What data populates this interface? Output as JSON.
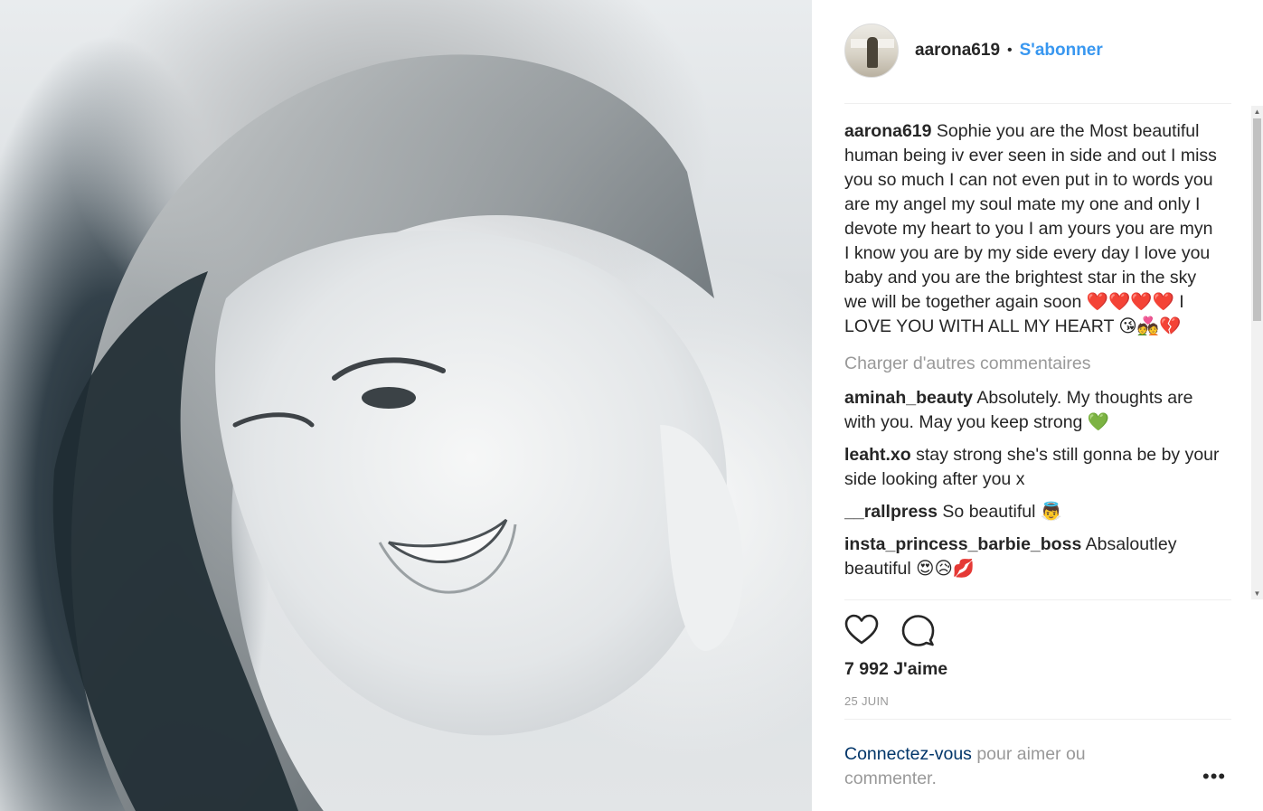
{
  "post": {
    "username": "aarona619",
    "separator": "•",
    "follow_label": "S'abonner",
    "caption_user": "aarona619",
    "caption_text": "Sophie you are the Most beautiful human being iv ever seen in side and out I miss you so much I can not even put in to words you are my angel my soul mate my one and only I devote my heart to you I am yours you are myn I know you are by my side every day I love you baby and you are the brightest star in the sky we will be together again soon ❤️❤️❤️❤️ I LOVE YOU WITH ALL MY HEART 😘💑💔",
    "load_more_label": "Charger d'autres commentaires",
    "comments": [
      {
        "user": "aminah_beauty",
        "text": "Absolutely. My thoughts are with you. May you keep strong 💚"
      },
      {
        "user": "leaht.xo",
        "text": "stay strong she's still gonna be by your side looking after you x"
      },
      {
        "user": "__rallpress",
        "text": "So beautiful 👼"
      },
      {
        "user": "insta_princess_barbie_boss",
        "text": "Absaloutley beautiful 😍😥💋"
      }
    ],
    "likes": "7 992 J'aime",
    "date": "25 JUIN",
    "login_link": "Connectez-vous",
    "login_text": " pour aimer ou commenter.",
    "more_glyph": "•••"
  },
  "icons": {
    "like": "heart-icon",
    "comment": "comment-bubble-icon",
    "more": "more-options-icon"
  },
  "colors": {
    "accent": "#3897f0",
    "text": "#262626",
    "muted": "#999999",
    "link_dark": "#003569"
  }
}
